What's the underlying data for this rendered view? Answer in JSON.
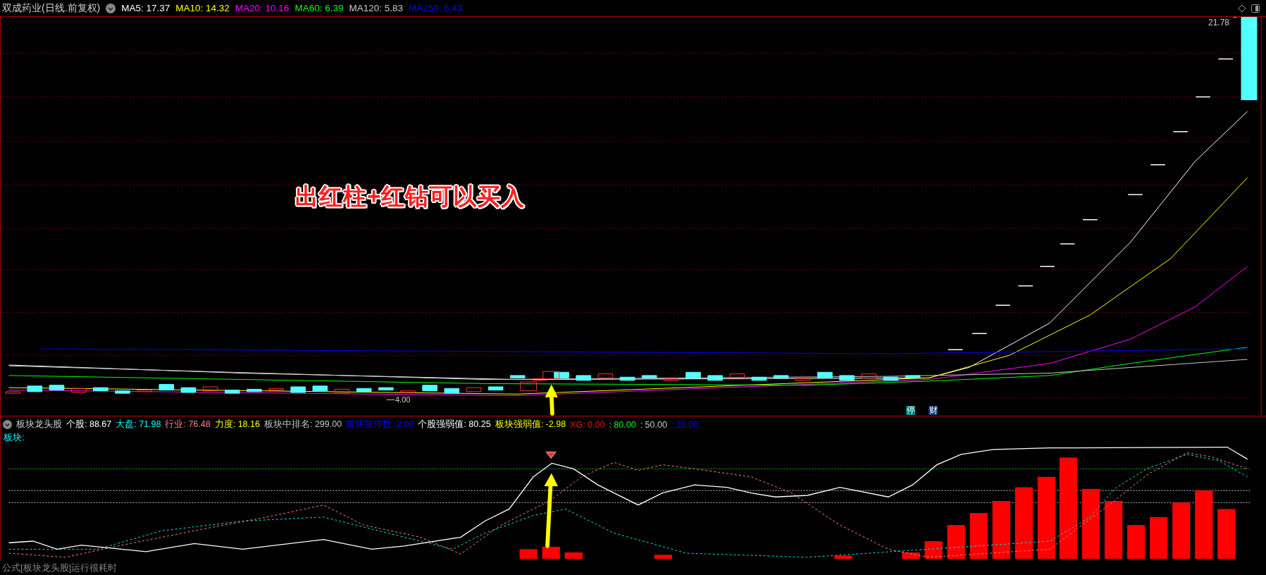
{
  "header": {
    "stock": "双成药业(日线.前复权)",
    "ma": [
      {
        "label": "MA5: 17.37",
        "color": "#ffffff"
      },
      {
        "label": "MA10: 14.32",
        "color": "#ffff00"
      },
      {
        "label": "MA20: 10.16",
        "color": "#ff00ff"
      },
      {
        "label": "MA60: 6.39",
        "color": "#00ff00"
      },
      {
        "label": "MA120: 5.83",
        "color": "#c8c8c8"
      },
      {
        "label": "MA250: 6.43",
        "color": "#0000ff"
      }
    ]
  },
  "price_chart": {
    "high_label": "21.78",
    "low_label": "4.00",
    "annotation": "出红柱+红钻可以买入",
    "badges": [
      {
        "text": "停",
        "color": "#008080"
      },
      {
        "text": "财",
        "color": "#0a3a6a"
      }
    ]
  },
  "indicator": {
    "name": "板块龙头股",
    "values": [
      {
        "label": "个股: 88.67",
        "color": "#ffffff"
      },
      {
        "label": "大盘: 71.98",
        "color": "#00ffff"
      },
      {
        "label": "行业: 76.48",
        "color": "#ff8080"
      },
      {
        "label": "力度: 18.16",
        "color": "#ffff00"
      },
      {
        "label": "板块中排名: 299.00",
        "color": "#c8c8c8"
      },
      {
        "label": "板块张停数: 2.00",
        "color": "#0000ff"
      },
      {
        "label": "个股强弱值: 80.25",
        "color": "#ffffff"
      },
      {
        "label": "板块强弱值: -2.98",
        "color": "#ffff00"
      },
      {
        "label": "XG: 0.00",
        "color": "#ff0000"
      },
      {
        "label": ": 80.00",
        "color": "#00ff00"
      },
      {
        "label": ": 50.00",
        "color": "#c8c8c8"
      },
      {
        "label": ": 20.00",
        "color": "#0000ff"
      }
    ],
    "sub_label": "板块:"
  },
  "status": "公式[板块龙头股]运行很耗时"
}
